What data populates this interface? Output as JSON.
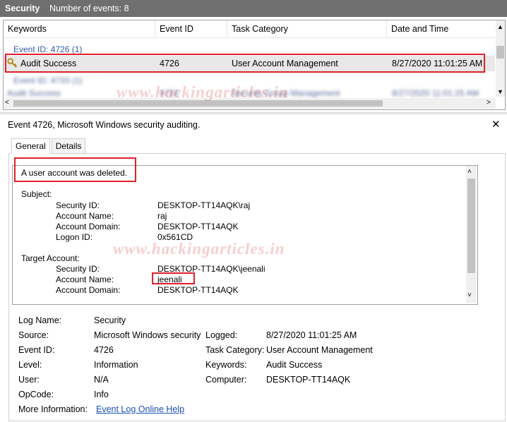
{
  "titlebar": {
    "log": "Security",
    "count_text": "Number of events: 8"
  },
  "grid": {
    "columns": [
      "Keywords",
      "Event ID",
      "Task Category",
      "Date and Time"
    ],
    "group_label": "Event ID: 4726 (1)",
    "selected_row": {
      "keywords": "Audit Success",
      "event_id": "4726",
      "task_category": "User Account Management",
      "date_time": "8/27/2020 11:01:25 AM"
    },
    "blurred_row": {
      "keywords": "Audit Success",
      "event_id": "4733",
      "task_category": "Security Group Management",
      "date_time": "8/27/2020 11:01:25 AM"
    },
    "blurred_group": "Event ID: 4733 (1)"
  },
  "watermark": "www.hackingarticles.in",
  "detail": {
    "header": "Event 4726, Microsoft Windows security auditing.",
    "tabs": [
      "General",
      "Details"
    ],
    "description": {
      "headline": "A user account was deleted.",
      "subject_label": "Subject:",
      "subject": [
        {
          "k": "Security ID:",
          "v": "DESKTOP-TT14AQK\\raj"
        },
        {
          "k": "Account Name:",
          "v": "raj"
        },
        {
          "k": "Account Domain:",
          "v": "DESKTOP-TT14AQK"
        },
        {
          "k": "Logon ID:",
          "v": "0x561CD"
        }
      ],
      "target_label": "Target Account:",
      "target": [
        {
          "k": "Security ID:",
          "v": "DESKTOP-TT14AQK\\jeenali"
        },
        {
          "k": "Account Name:",
          "v": "jeenali"
        },
        {
          "k": "Account Domain:",
          "v": "DESKTOP-TT14AQK"
        }
      ]
    },
    "fields": {
      "log_name_label": "Log Name:",
      "log_name": "Security",
      "source_label": "Source:",
      "source": "Microsoft Windows security",
      "logged_label": "Logged:",
      "logged": "8/27/2020 11:01:25 AM",
      "event_id_label": "Event ID:",
      "event_id": "4726",
      "task_category_label": "Task Category:",
      "task_category": "User Account Management",
      "level_label": "Level:",
      "level": "Information",
      "keywords_label": "Keywords:",
      "keywords": "Audit Success",
      "user_label": "User:",
      "user": "N/A",
      "computer_label": "Computer:",
      "computer": "DESKTOP-TT14AQK",
      "opcode_label": "OpCode:",
      "opcode": "Info",
      "more_info_label": "More Information:",
      "more_info_link": "Event Log Online Help"
    }
  },
  "colors": {
    "highlight": "#e0202a",
    "titlebar": "#6f6f6f",
    "link": "#1a4fb3"
  }
}
